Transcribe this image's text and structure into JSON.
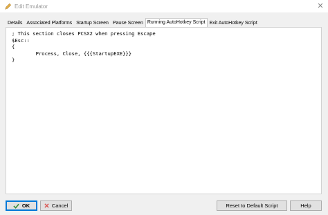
{
  "window": {
    "title": "Edit Emulator",
    "close_glyph": "✕",
    "title_icon": "pencil-icon"
  },
  "tabs": [
    {
      "label": "Details",
      "active": false
    },
    {
      "label": "Associated Platforms",
      "active": false
    },
    {
      "label": "Startup Screen",
      "active": false
    },
    {
      "label": "Pause Screen",
      "active": false
    },
    {
      "label": "Running AutoHotkey Script",
      "active": true
    },
    {
      "label": "Exit AutoHotkey Script",
      "active": false
    }
  ],
  "editor": {
    "content": "; This section closes PCSX2 when pressing Escape\n$Esc::\n{\n        Process, Close, {{{StartupEXE}}}\n}"
  },
  "footer": {
    "ok_label": "OK",
    "cancel_label": "Cancel",
    "reset_label": "Reset to Default Script",
    "help_label": "Help",
    "ok_icon": "checkmark-icon",
    "cancel_icon": "x-icon"
  },
  "colors": {
    "accent": "#0078d7",
    "ok_check": "#3a8f3a",
    "cancel_x": "#d9534f"
  }
}
